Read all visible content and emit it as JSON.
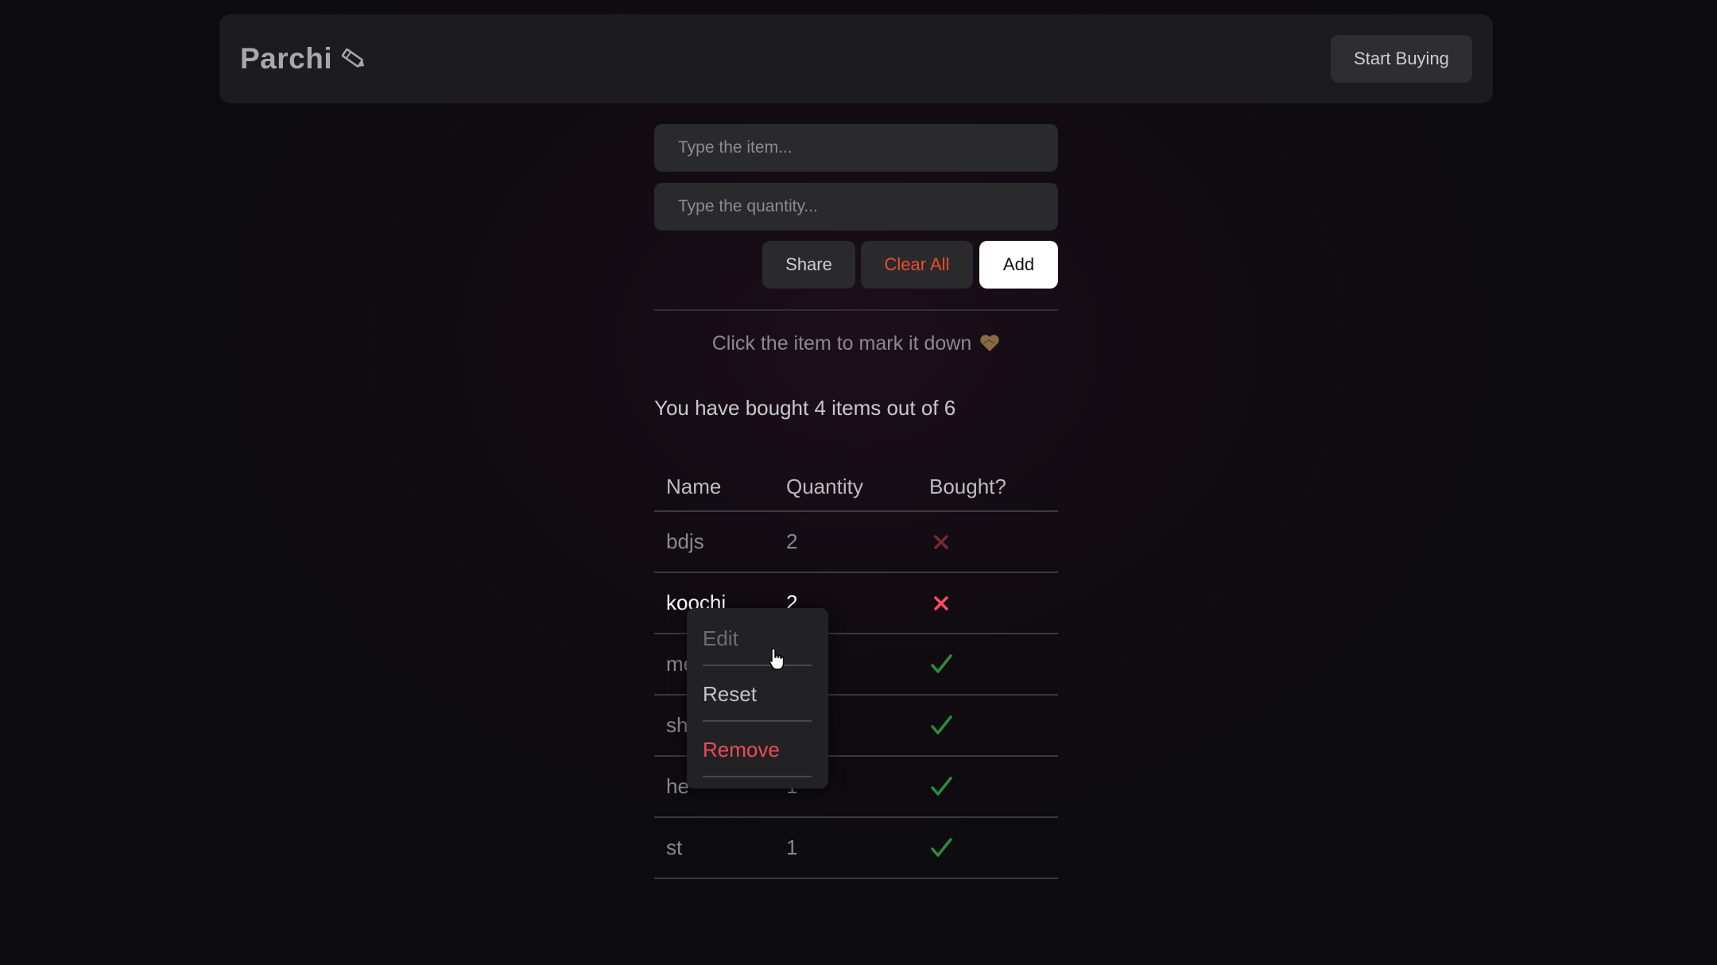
{
  "header": {
    "title": "Parchi",
    "title_icon": "pencil-icon",
    "start_label": "Start Buying"
  },
  "form": {
    "item_placeholder": "Type the item...",
    "quantity_placeholder": "Type the quantity...",
    "share_label": "Share",
    "clear_label": "Clear All",
    "add_label": "Add"
  },
  "hint": {
    "text": "Click the item to mark it down",
    "icon": "heart-icon"
  },
  "summary": "You have bought 4 items out of 6",
  "table": {
    "headers": [
      "Name",
      "Quantity",
      "Bought?"
    ],
    "rows": [
      {
        "name": "bdjs",
        "quantity": "2",
        "bought": false
      },
      {
        "name": "koochi",
        "quantity": "2",
        "bought": false
      },
      {
        "name": "me",
        "quantity": "",
        "bought": true
      },
      {
        "name": "sh",
        "quantity": "",
        "bought": true
      },
      {
        "name": "he",
        "quantity": "1",
        "bought": true
      },
      {
        "name": "st",
        "quantity": "1",
        "bought": true
      }
    ]
  },
  "context_menu": {
    "edit_label": "Edit",
    "reset_label": "Reset",
    "remove_label": "Remove"
  },
  "colors": {
    "accent_red": "#ee4b2b",
    "cross_red": "#ff4d5a",
    "check_green": "#2e8b3c"
  }
}
